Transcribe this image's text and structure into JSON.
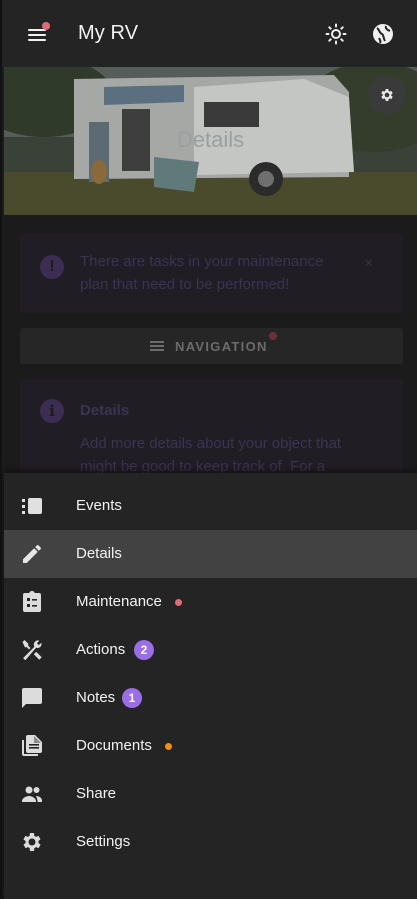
{
  "app": {
    "title": "My RV"
  },
  "header": {
    "menu_icon": "hamburger-menu-icon",
    "theme_icon": "brightness-icon",
    "language_icon": "globe-icon",
    "menu_dot_color": "#e06c79"
  },
  "hero": {
    "title": "Details",
    "settings_icon": "gear-icon"
  },
  "alert": {
    "text": "There are tasks in your maintenance plan that need to be performed!",
    "icon": "exclamation-icon",
    "close_label": "×"
  },
  "navigation_button": {
    "label": "NAVIGATION",
    "icon": "menu-lines-icon"
  },
  "info_card": {
    "title": "Details",
    "text": "Add more details about your object that might be good to keep track of. For a",
    "icon": "info-icon"
  },
  "drawer": {
    "items": [
      {
        "label": "Events",
        "icon": "events-icon",
        "active": false
      },
      {
        "label": "Details",
        "icon": "pencil-icon",
        "active": true
      },
      {
        "label": "Maintenance",
        "icon": "clipboard-icon",
        "active": false,
        "dot_color": "#e06c79"
      },
      {
        "label": "Actions",
        "icon": "tools-icon",
        "active": false,
        "badge": "2"
      },
      {
        "label": "Notes",
        "icon": "comment-icon",
        "active": false,
        "badge": "1"
      },
      {
        "label": "Documents",
        "icon": "document-icon",
        "active": false,
        "dot_color": "#f0910f"
      },
      {
        "label": "Share",
        "icon": "people-icon",
        "active": false
      },
      {
        "label": "Settings",
        "icon": "gear-icon",
        "active": false
      }
    ]
  },
  "colors": {
    "accent": "#9b6ee8",
    "drawer_bg": "#242424",
    "active_bg": "#424242"
  }
}
